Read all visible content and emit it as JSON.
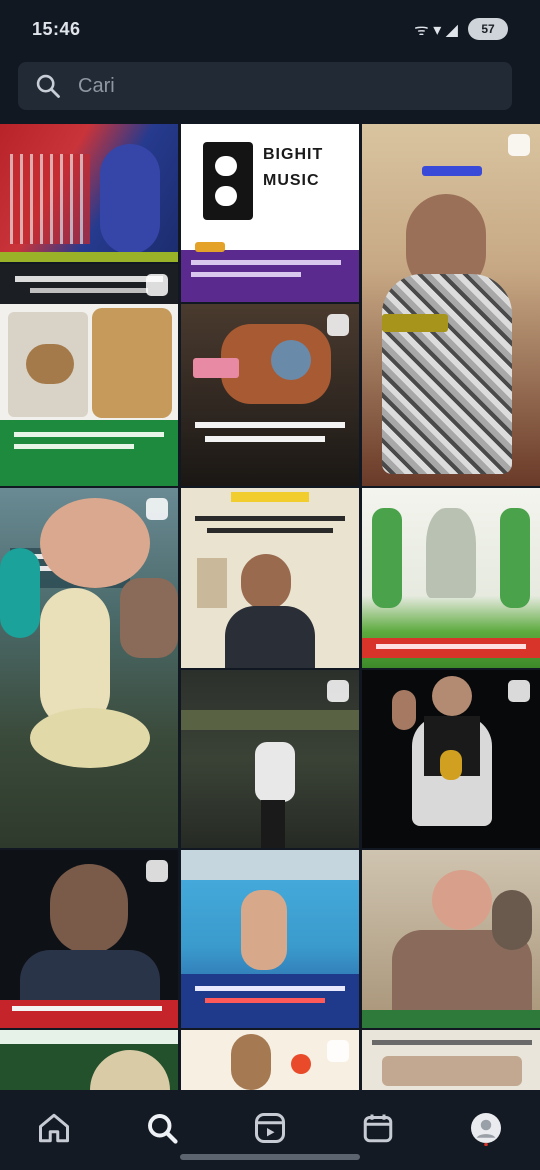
{
  "status_bar": {
    "time": "15:46",
    "signal": "ᯤ ▾ ◢",
    "battery": "57"
  },
  "search": {
    "placeholder": "Cari"
  },
  "grid": {
    "tiles": [
      {
        "caption": ""
      },
      {
        "brand_title": "BIGHIT",
        "brand_subtitle": "MUSIC",
        "caption": ""
      },
      {
        "caption": ""
      },
      {
        "caption": ""
      },
      {
        "caption": ""
      },
      {
        "caption": ""
      },
      {
        "caption": ""
      },
      {
        "caption": ""
      },
      {
        "caption": ""
      },
      {
        "caption": ""
      },
      {
        "caption": ""
      },
      {
        "caption": ""
      },
      {
        "caption": ""
      },
      {
        "caption": ""
      },
      {
        "caption": ""
      }
    ]
  },
  "nav": {
    "items": [
      "home-icon",
      "search-icon",
      "reels-icon",
      "shop-icon",
      "profile-icon"
    ]
  },
  "colors": {
    "background": "#121821",
    "nav_background": "#141a23",
    "search_background": "#222a36",
    "accent_red": "#d8322a"
  }
}
